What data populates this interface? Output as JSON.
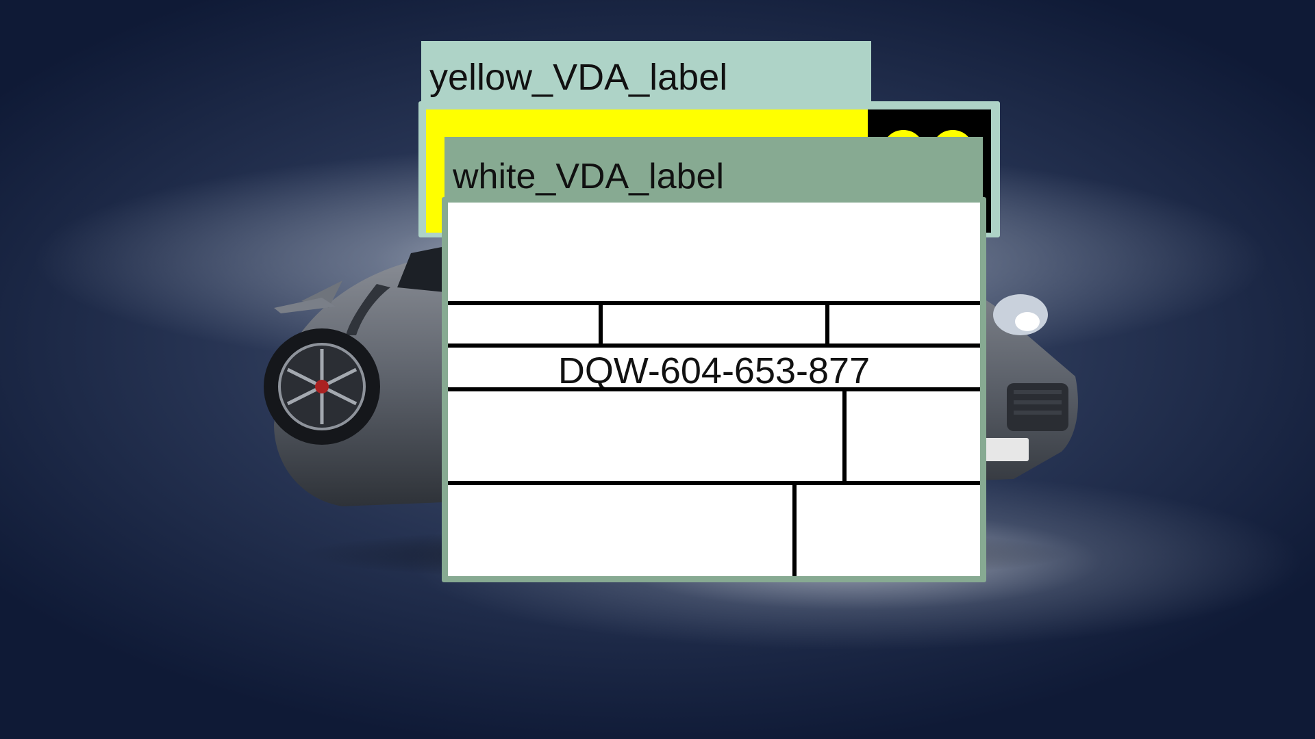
{
  "labels": {
    "yellow_title": "yellow_VDA_label",
    "white_title": "white_VDA_label",
    "white_plate_number": "DQW-604-653-877"
  },
  "colors": {
    "yellow_title_bar": "#aed3c7",
    "white_title_bar": "#87aa92",
    "yellow_label_fill": "#ffff00",
    "yellow_label_dark": "#000000",
    "white_label_fill": "#ffffff",
    "background": "#1a2644"
  },
  "icons": {
    "background_image": "car-photo",
    "yellow_label_glyph": "yellow-circles-glyph"
  }
}
